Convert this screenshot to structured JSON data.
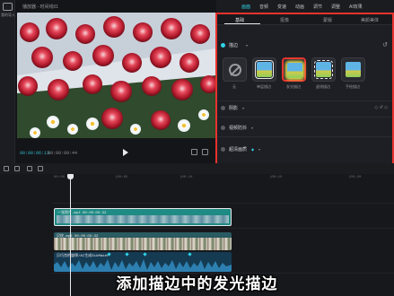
{
  "sidebar": {
    "label": "我的导入"
  },
  "player": {
    "title": "播放器 - 时间线01",
    "time_current": "00:00:06:13",
    "time_total": "00:00:09:44"
  },
  "top_tabs": [
    {
      "label": "画面",
      "active": true
    },
    {
      "label": "音频",
      "active": false
    },
    {
      "label": "变速",
      "active": false
    },
    {
      "label": "动画",
      "active": false
    },
    {
      "label": "调节",
      "active": false
    },
    {
      "label": "调整",
      "active": false
    },
    {
      "label": "AI效果",
      "active": false
    }
  ],
  "panel": {
    "subtabs": [
      {
        "label": "基础",
        "active": true
      },
      {
        "label": "抠像",
        "active": false
      },
      {
        "label": "蒙版",
        "active": false
      },
      {
        "label": "美颜美体",
        "active": false
      }
    ],
    "stroke": {
      "label": "描边",
      "options": [
        {
          "label": "无",
          "icon": "none-icon"
        },
        {
          "label": "单层描边",
          "icon": "single-stroke-icon"
        },
        {
          "label": "发光描边",
          "icon": "glow-stroke-icon",
          "selected": true
        },
        {
          "label": "虚线描边",
          "icon": "dashed-stroke-icon"
        },
        {
          "label": "手绘描边",
          "icon": "handdrawn-stroke-icon"
        }
      ]
    },
    "sections": [
      {
        "label": "阴影"
      },
      {
        "label": "视频防抖"
      },
      {
        "label": "超清画质"
      }
    ]
  },
  "ruler": {
    "ticks": [
      "00:00",
      "|00:05",
      "|00:10",
      "|00:15",
      "|00:20"
    ]
  },
  "timeline": {
    "clip_main_label": "一张照片.mp4  00:00:09:32",
    "clip_b_label": "贝纹.mp4  00:00:09:32",
    "clip_audio_label": "贝巧克的旋律/AI生成SikMaker"
  },
  "subtitle": "添加描边中的发光描边",
  "colors": {
    "accent": "#2fd3e6",
    "highlight_frame": "#e8322e",
    "timecode": "#2fb7c9"
  }
}
